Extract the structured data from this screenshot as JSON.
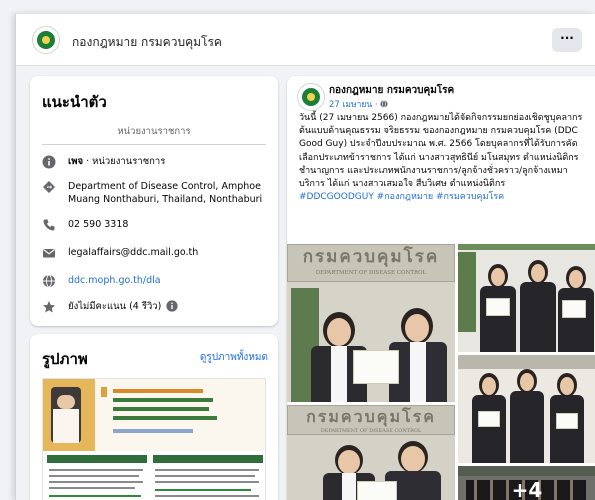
{
  "page": {
    "name": "กองกฎหมาย กรมควบคุมโรค",
    "more_label": "···"
  },
  "intro": {
    "title": "แนะนำตัว",
    "subtitle": "หน่วยงานราชการ",
    "category_bold": "เพจ",
    "category_rest": " · หน่วยงานราชการ",
    "address": "Department of Disease Control, Amphoe Muang Nonthaburi, Thailand, Nonthaburi",
    "phone": "02 590 3318",
    "email": "legalaffairs@ddc.mail.go.th",
    "website": "ddc.moph.go.th/dla",
    "rating": "ยังไม่มีคะแนน (4 รีวิว)"
  },
  "photos": {
    "title": "รูปภาพ",
    "see_all": "ดูรูปภาพทั้งหมด",
    "thumb_text_1": "ดูรูปภาพทั้งหมด",
    "thumb_text_2": "ดูรูปภาพทั้งหมด"
  },
  "post": {
    "author": "กองกฎหมาย กรมควบคุมโรค",
    "date": "27 เมษายน · ",
    "body": "วันนี้ (27 เมษายน 2566) กองกฎหมายได้จัดกิจกรรมยกย่องเชิดชูบุคลากรต้นแบบด้านคุณธรรม จริยธรรม ของกองกฎหมาย กรมควบคุมโรค (DDC Good Guy) ประจำปีงบประมาณ พ.ศ. 2566 โดยบุคลากรที่ได้รับการคัดเลือกประเภทข้าราชการ ได้แก่ นางสาวสุทธินีย์ มโนสมุทร ตำแหน่งนิติกรชำนาญการ และประเภทพนักงานราชการ/ลูกจ้างชั่วคราว/ลูกจ้างเหมาบริการ ได้แก่ นางสาวเสมอใจ สืบวิเศษ ตำแหน่งนิติกร",
    "hashtags": "#DDCGOODGUY #กองกฎหมาย #กรมควบคุมโรค",
    "sign_text": "กรมควบคุมโรค",
    "sign_sub": "DEPARTMENT OF DISEASE CONTROL",
    "more_photos": "+4"
  },
  "colors": {
    "link": "#216fdb",
    "logo_green": "#1a7f3a",
    "page_bg": "#f0f2f5"
  },
  "icons": [
    "info-icon",
    "location-icon",
    "phone-icon",
    "email-icon",
    "globe-icon",
    "star-icon"
  ]
}
